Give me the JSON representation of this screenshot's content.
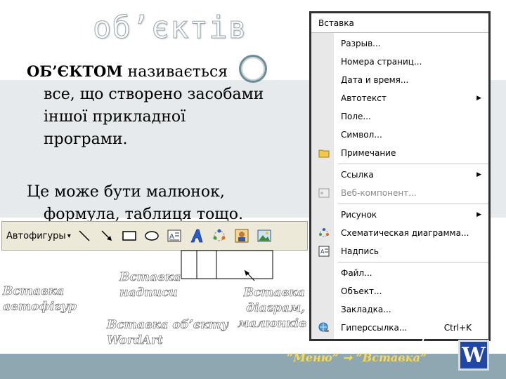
{
  "slide": {
    "title": "об’єктів",
    "definition_term": "ОБ’ЄКТОМ",
    "definition_rest": "називається",
    "definition_line2": "все, що створено засобами",
    "definition_line3": "іншої прикладної",
    "definition_line4": "програми.",
    "para2_line1": "Це може бути малюнок,",
    "para2_line2": "формула, таблиця тощо."
  },
  "toolbar": {
    "autoshapes_label": "Автофигуры",
    "autoshapes_arrow": "▾"
  },
  "menu": {
    "title": "Вставка",
    "items": [
      {
        "label": "Разрыв..."
      },
      {
        "label": "Номера страниц..."
      },
      {
        "label": "Дата и время..."
      },
      {
        "label": "Автотекст",
        "submenu": "▶"
      },
      {
        "label": "Поле..."
      },
      {
        "label": "Символ..."
      },
      {
        "label": "Примечание"
      },
      {
        "label": "Ссылка",
        "submenu": "▶"
      },
      {
        "label": "Веб-компонент..."
      },
      {
        "label": "Рисунок",
        "submenu": "▶"
      },
      {
        "label": "Схематическая диаграмма..."
      },
      {
        "label": "Надпись"
      },
      {
        "label": "Файл..."
      },
      {
        "label": "Объект..."
      },
      {
        "label": "Закладка..."
      },
      {
        "label": "Гиперссылка...",
        "shortcut": "Ctrl+K"
      }
    ]
  },
  "labels": {
    "insert_autoshapes_1": "Вставка",
    "insert_autoshapes_2": "автофігур",
    "insert_textbox_1": "Вставка",
    "insert_textbox_2": "надписи",
    "insert_diagram_1": "Вставка",
    "insert_diagram_2": "діаграм,",
    "insert_diagram_3": "малюнків",
    "insert_wordart_1": "Вставка об’єкту",
    "insert_wordart_2": "WordArt",
    "menu_caption": "“Меню” ➞ ”Вставка”"
  },
  "logo": {
    "letter": "W"
  }
}
